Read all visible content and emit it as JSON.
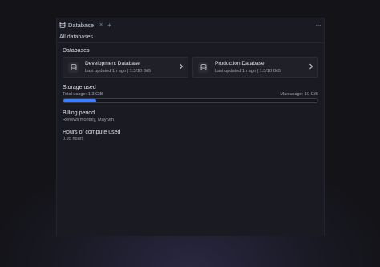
{
  "tab": {
    "label": "Database",
    "close": "×",
    "add": "+",
    "more": "···",
    "icon": "database-icon"
  },
  "subheader": {
    "title": "All databases"
  },
  "databases": {
    "title": "Databases",
    "items": [
      {
        "name": "Development Database",
        "meta": "Last updated 1h ago  |  1.3/10 GiB",
        "icon": "database-icon"
      },
      {
        "name": "Production Database",
        "meta": "Last updated 1h ago  |  1.3/10 GiB",
        "icon": "database-icon"
      }
    ]
  },
  "storage": {
    "title": "Storage used",
    "total_label": "Total usage: 1.3 GiB",
    "max_label": "Max usage: 10 GiB",
    "used_fraction": 0.13,
    "accent": "#3d7dff"
  },
  "billing": {
    "title": "Billing period",
    "value": "Renews monthly, May 9th"
  },
  "compute": {
    "title": "Hours of compute used",
    "value": "0.95 hours"
  }
}
